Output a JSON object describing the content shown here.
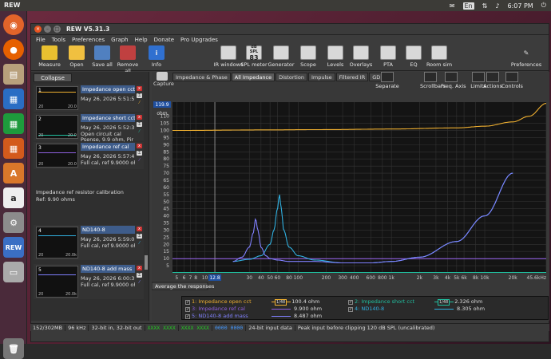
{
  "system": {
    "app_name": "REW",
    "lang": "En",
    "time": "6:07 PM"
  },
  "window": {
    "title": "REW V5.31.3"
  },
  "menu": [
    "File",
    "Tools",
    "Preferences",
    "Graph",
    "Help",
    "Donate",
    "Pro Upgrades"
  ],
  "toolbar": {
    "left": [
      {
        "label": "Measure",
        "icon": "measure-icon"
      },
      {
        "label": "Open",
        "icon": "open-folder-icon"
      },
      {
        "label": "Save all",
        "icon": "save-all-icon"
      },
      {
        "label": "Remove all",
        "icon": "remove-all-icon"
      },
      {
        "label": "Info",
        "icon": "info-icon"
      }
    ],
    "right": [
      {
        "label": "IR windows",
        "icon": "ir-windows-icon"
      },
      {
        "label": "SPL meter",
        "icon": "spl-meter-icon",
        "badge_top": "dB SPL",
        "badge": "83"
      },
      {
        "label": "Generator",
        "icon": "generator-icon"
      },
      {
        "label": "Scope",
        "icon": "scope-icon"
      },
      {
        "label": "Levels",
        "icon": "levels-icon"
      },
      {
        "label": "Overlays",
        "icon": "overlays-icon"
      },
      {
        "label": "PTA",
        "icon": "pta-icon"
      },
      {
        "label": "EQ",
        "icon": "eq-icon"
      },
      {
        "label": "Room sim",
        "icon": "room-sim-icon"
      }
    ],
    "preferences": "Preferences"
  },
  "left_panel": {
    "collapse_label": "Collapse",
    "measurements": [
      {
        "num": "1",
        "name": "Impedance open cct",
        "date": "May 26, 2026 5:51:59",
        "extra": "",
        "tick": "20",
        "tick2": "20.0"
      },
      {
        "num": "2",
        "name": "Impedance short cct",
        "date": "May 26, 2026 5:52:39",
        "extra": "Open circuit cal",
        "extra2": "Psense, 9.9 ohm, Pir",
        "tick": "20",
        "tick2": "20.0"
      },
      {
        "num": "3",
        "name": "Impedance ref cal",
        "date": "May 26, 2026 5:57:47",
        "extra": "Full cal, ref 9.9000 oh",
        "tick": "20",
        "tick2": "20.0"
      },
      {
        "num": "4",
        "name": "ND140-8",
        "date": "May 26, 2026 5:59:01",
        "extra": "Full cal, ref 9.9000 oh",
        "tick": "20",
        "tick2": "20.0k"
      },
      {
        "num": "5",
        "name": "ND140-8 add mass",
        "date": "May 26, 2026 6:00:39",
        "extra": "Full cal, ref 9.9000 oh",
        "tick": "20",
        "tick2": "20.0k"
      }
    ],
    "note1": "Impedance ref resistor calibration",
    "note2": "Ref: 9.90 ohms"
  },
  "graph": {
    "capture_label": "Capture",
    "tabs": [
      "Impedance & Phase",
      "All Impedance",
      "Distortion",
      "Impulse",
      "Filtered IR",
      "GD"
    ],
    "selected_tab": "All Impedance",
    "controls": [
      {
        "label": "Separate",
        "icon": "separate-icon"
      },
      {
        "label": "Scrollbars",
        "icon": "scrollbars-icon"
      },
      {
        "label": "Freq. Axis",
        "icon": "freq-axis-icon"
      },
      {
        "label": "Limits",
        "icon": "limits-icon"
      },
      {
        "label": "Actions",
        "icon": "actions-icon"
      },
      {
        "label": "Controls",
        "icon": "controls-icon"
      }
    ],
    "top_value": "119.9",
    "unit": "ohm",
    "cursor_x": "12.8",
    "average_label": "Average the responses"
  },
  "chart_data": {
    "type": "line",
    "xscale": "log",
    "xlim": [
      4.5,
      45600
    ],
    "ylim": [
      0,
      119.9
    ],
    "ylabel": "ohm",
    "yticks": [
      5,
      10,
      15,
      20,
      25,
      30,
      35,
      40,
      45,
      50,
      55,
      60,
      65,
      70,
      75,
      80,
      85,
      90,
      95,
      100,
      105,
      110
    ],
    "xticks": [
      {
        "v": 5,
        "l": "5"
      },
      {
        "v": 6,
        "l": "6"
      },
      {
        "v": 7,
        "l": "7"
      },
      {
        "v": 8,
        "l": "8"
      },
      {
        "v": 10,
        "l": "10"
      },
      {
        "v": 30,
        "l": "30"
      },
      {
        "v": 40,
        "l": "40"
      },
      {
        "v": 50,
        "l": "50"
      },
      {
        "v": 60,
        "l": "60"
      },
      {
        "v": 80,
        "l": "80"
      },
      {
        "v": 100,
        "l": "100"
      },
      {
        "v": 200,
        "l": "200"
      },
      {
        "v": 300,
        "l": "300"
      },
      {
        "v": 400,
        "l": "400"
      },
      {
        "v": 600,
        "l": "600"
      },
      {
        "v": 800,
        "l": "800"
      },
      {
        "v": 1000,
        "l": "1k"
      },
      {
        "v": 2000,
        "l": "2k"
      },
      {
        "v": 3000,
        "l": "3k"
      },
      {
        "v": 4000,
        "l": "4k"
      },
      {
        "v": 5000,
        "l": "5k"
      },
      {
        "v": 6000,
        "l": "6k"
      },
      {
        "v": 8000,
        "l": "8k"
      },
      {
        "v": 10000,
        "l": "10k"
      },
      {
        "v": 20000,
        "l": "20k"
      },
      {
        "v": 45600,
        "l": "45.6kHz"
      }
    ],
    "series": [
      {
        "name": "1: Impedance open cct",
        "color": "#f0b030",
        "x": [
          4.5,
          50,
          200,
          1000,
          5000,
          10000,
          20000,
          30000,
          45600
        ],
        "y": [
          100,
          100.4,
          100.6,
          101,
          101.8,
          103,
          106,
          110,
          119
        ]
      },
      {
        "name": "2: Impedance short cct",
        "color": "#20c0a0",
        "x": [
          4.5,
          45600
        ],
        "y": [
          0.3,
          0.3
        ]
      },
      {
        "name": "3: Impedance ref cal",
        "color": "#9060e0",
        "x": [
          4.5,
          45600
        ],
        "y": [
          9.9,
          9.9
        ]
      },
      {
        "name": "4: ND140-8",
        "color": "#30b0e0",
        "x": [
          20,
          30,
          40,
          50,
          55,
          60,
          63,
          66,
          70,
          80,
          100,
          150,
          300,
          600,
          1000,
          2000,
          5000,
          10000,
          20000
        ],
        "y": [
          8,
          9.5,
          12,
          20,
          30,
          45,
          55,
          45,
          30,
          18,
          12,
          9,
          7,
          7,
          8,
          11,
          22,
          40,
          70
        ]
      },
      {
        "name": "5: ND140-8 add mass",
        "color": "#8080ff",
        "x": [
          20,
          25,
          30,
          33,
          35,
          37,
          40,
          45,
          50,
          60,
          80,
          150,
          300,
          600,
          1000,
          2000,
          5000,
          10000,
          20000
        ],
        "y": [
          8,
          11,
          18,
          28,
          38,
          30,
          18,
          12,
          10,
          9,
          8,
          8,
          7,
          7,
          8,
          11,
          22,
          40,
          70
        ]
      }
    ],
    "legend": [
      {
        "label": "1: Impedance open cct",
        "value": "100.4 ohm",
        "color": "#f0b030",
        "badge": "1/48"
      },
      {
        "label": "2: Impedance short cct",
        "value": "2.326 ohm",
        "color": "#20c0a0",
        "badge": "1/48"
      },
      {
        "label": "3: Impedance ref cal",
        "value": "9.900 ohm",
        "color": "#9060e0",
        "badge": ""
      },
      {
        "label": "4: ND140-8",
        "value": "8.305 ohm",
        "color": "#30b0e0",
        "badge": ""
      },
      {
        "label": "5: ND140-8 add mass",
        "value": "8.487 ohm",
        "color": "#8080ff",
        "badge": ""
      }
    ]
  },
  "status": {
    "mem": "152/302MB",
    "rate": "96 kHz",
    "bits": "32-bit in, 32-bit out",
    "xxxx1": "XXXX XXXX",
    "xxxx2": "XXXX XXXX",
    "zeros": "0000 0000",
    "input": "24-bit input data",
    "peak": "Peak input before clipping 120 dB SPL (uncalibrated)"
  }
}
